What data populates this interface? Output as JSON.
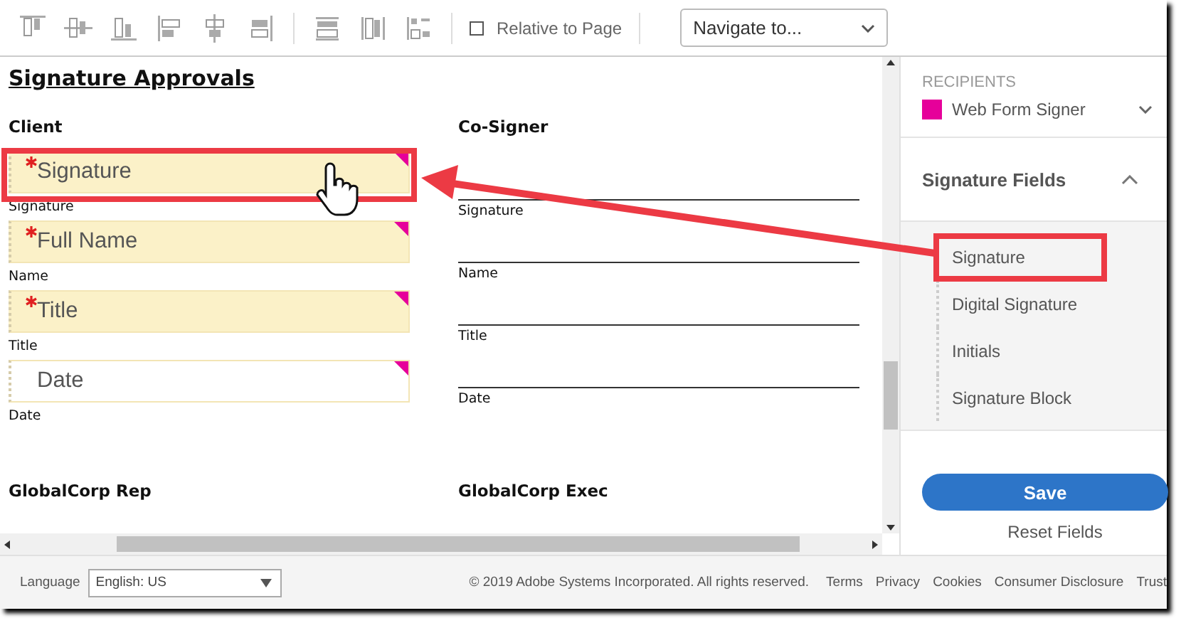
{
  "toolbar": {
    "tools": [
      {
        "kind": "align-top"
      },
      {
        "kind": "align-middle"
      },
      {
        "kind": "align-bottom"
      },
      {
        "kind": "align-left"
      },
      {
        "kind": "align-center"
      },
      {
        "kind": "align-right"
      },
      {
        "kind": "distribute-vertical"
      },
      {
        "kind": "distribute-horizontal"
      },
      {
        "kind": "arrange"
      }
    ],
    "relative_to_page": {
      "label": "Relative to Page",
      "checked": false
    },
    "navigate": {
      "value": "Navigate to..."
    }
  },
  "document": {
    "title": "Signature Approvals",
    "client": {
      "heading": "Client",
      "fields": [
        {
          "value": "Signature",
          "required": true,
          "label": "Signature"
        },
        {
          "value": "Full Name",
          "required": true,
          "label": "Name"
        },
        {
          "value": "Title",
          "required": true,
          "label": "Title"
        },
        {
          "value": "Date",
          "required": false,
          "label": "Date"
        }
      ]
    },
    "co_signer": {
      "heading": "Co-Signer",
      "lines": [
        {
          "label": "Signature"
        },
        {
          "label": "Name"
        },
        {
          "label": "Title"
        },
        {
          "label": "Date"
        }
      ]
    },
    "sections": [
      {
        "heading": "GlobalCorp Rep"
      },
      {
        "heading": "GlobalCorp Exec"
      }
    ]
  },
  "sidebar": {
    "recipients_heading": "RECIPIENTS",
    "recipient": {
      "name": "Web Form Signer",
      "color": "#e6009a"
    },
    "signature_fields": {
      "heading": "Signature Fields",
      "expanded": true,
      "items": [
        {
          "label": "Signature",
          "highlighted": true
        },
        {
          "label": "Digital Signature",
          "highlighted": false
        },
        {
          "label": "Initials",
          "highlighted": false
        },
        {
          "label": "Signature Block",
          "highlighted": false
        }
      ]
    },
    "save": "Save",
    "reset": "Reset Fields"
  },
  "footer": {
    "language_label": "Language",
    "language": "English: US",
    "copyright": "© 2019 Adobe Systems Incorporated. All rights reserved.",
    "links": [
      "Terms",
      "Privacy",
      "Cookies",
      "Consumer Disclosure",
      "Trust"
    ]
  }
}
